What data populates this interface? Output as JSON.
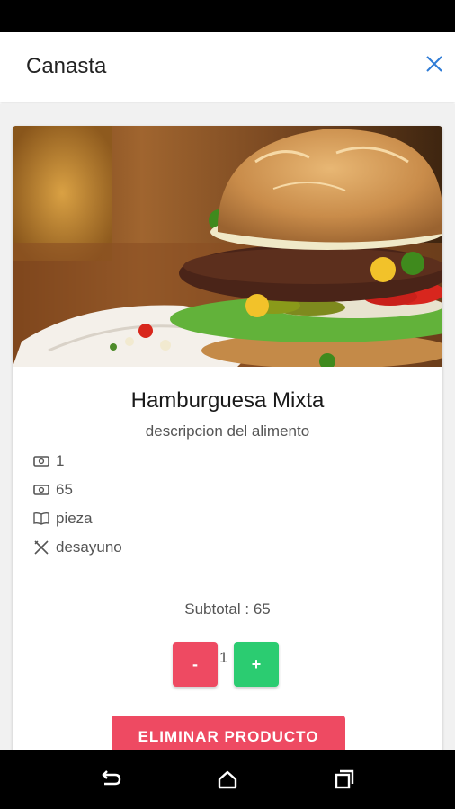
{
  "header": {
    "title": "Canasta"
  },
  "product": {
    "name": "Hamburguesa Mixta",
    "description": "descripcion del alimento",
    "info": [
      {
        "icon": "money-icon",
        "value": "1"
      },
      {
        "icon": "money-icon",
        "value": "65"
      },
      {
        "icon": "book-icon",
        "value": "pieza"
      },
      {
        "icon": "utensils-icon",
        "value": "desayuno"
      }
    ],
    "subtotal_label": "Subtotal : ",
    "subtotal_value": "65"
  },
  "quantity": {
    "minus_label": "-",
    "value": "1",
    "plus_label": "+"
  },
  "actions": {
    "delete_label": "ELIMINAR PRODUCTO"
  },
  "colors": {
    "accent_red": "#ee4a62",
    "accent_green": "#2bcc71",
    "close_blue": "#2e7bd6"
  }
}
